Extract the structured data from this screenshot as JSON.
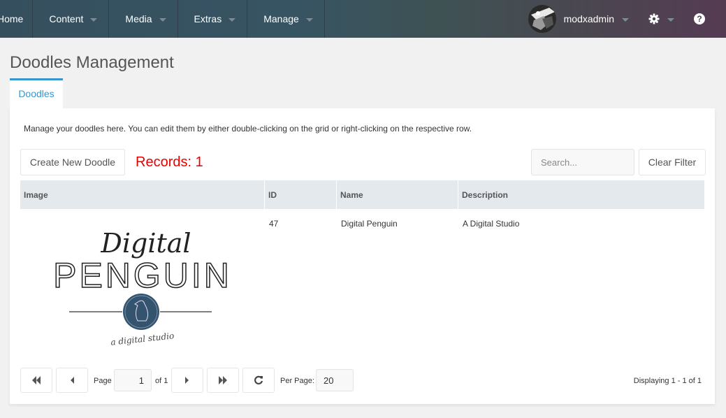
{
  "topbar": {
    "nav": [
      {
        "label": "Home",
        "has_caret": false
      },
      {
        "label": "Content",
        "has_caret": true
      },
      {
        "label": "Media",
        "has_caret": true
      },
      {
        "label": "Extras",
        "has_caret": true
      },
      {
        "label": "Manage",
        "has_caret": true
      }
    ],
    "username": "modxadmin",
    "icons": {
      "user_menu": "caret-down-icon",
      "settings": "gear-icon",
      "help": "question-circle-icon"
    },
    "help_glyph": "?"
  },
  "page": {
    "title": "Doodles Management",
    "tabs": [
      {
        "label": "Doodles",
        "active": true
      }
    ],
    "intro": "Manage your doodles here. You can edit them by either double-clicking on the grid or right-clicking on the respective row."
  },
  "toolbar": {
    "create_label": "Create New Doodle",
    "records_text": "Records: 1",
    "records_color": "#e80000",
    "search_placeholder": "Search...",
    "search_value": "",
    "clear_filter_label": "Clear Filter"
  },
  "grid": {
    "columns": [
      "Image",
      "ID",
      "Name",
      "Description"
    ],
    "rows": [
      {
        "image": {
          "line1": "Digital",
          "line2": "PENGUIN",
          "tagline": "a digital studio",
          "badge_color": "#33536f"
        },
        "id": "47",
        "name": "Digital Penguin",
        "description": "A Digital Studio"
      }
    ]
  },
  "pagination": {
    "page_label": "Page",
    "page_value": "1",
    "of_label": "of 1",
    "per_page_label": "Per Page:",
    "per_page_value": "20",
    "displaying": "Displaying 1 - 1 of 1",
    "icons": {
      "first": "first-page-icon",
      "prev": "prev-page-icon",
      "next": "next-page-icon",
      "last": "last-page-icon",
      "refresh": "refresh-icon"
    }
  },
  "colors": {
    "accent": "#3697cd",
    "header_bg": "#e4e9ee"
  }
}
